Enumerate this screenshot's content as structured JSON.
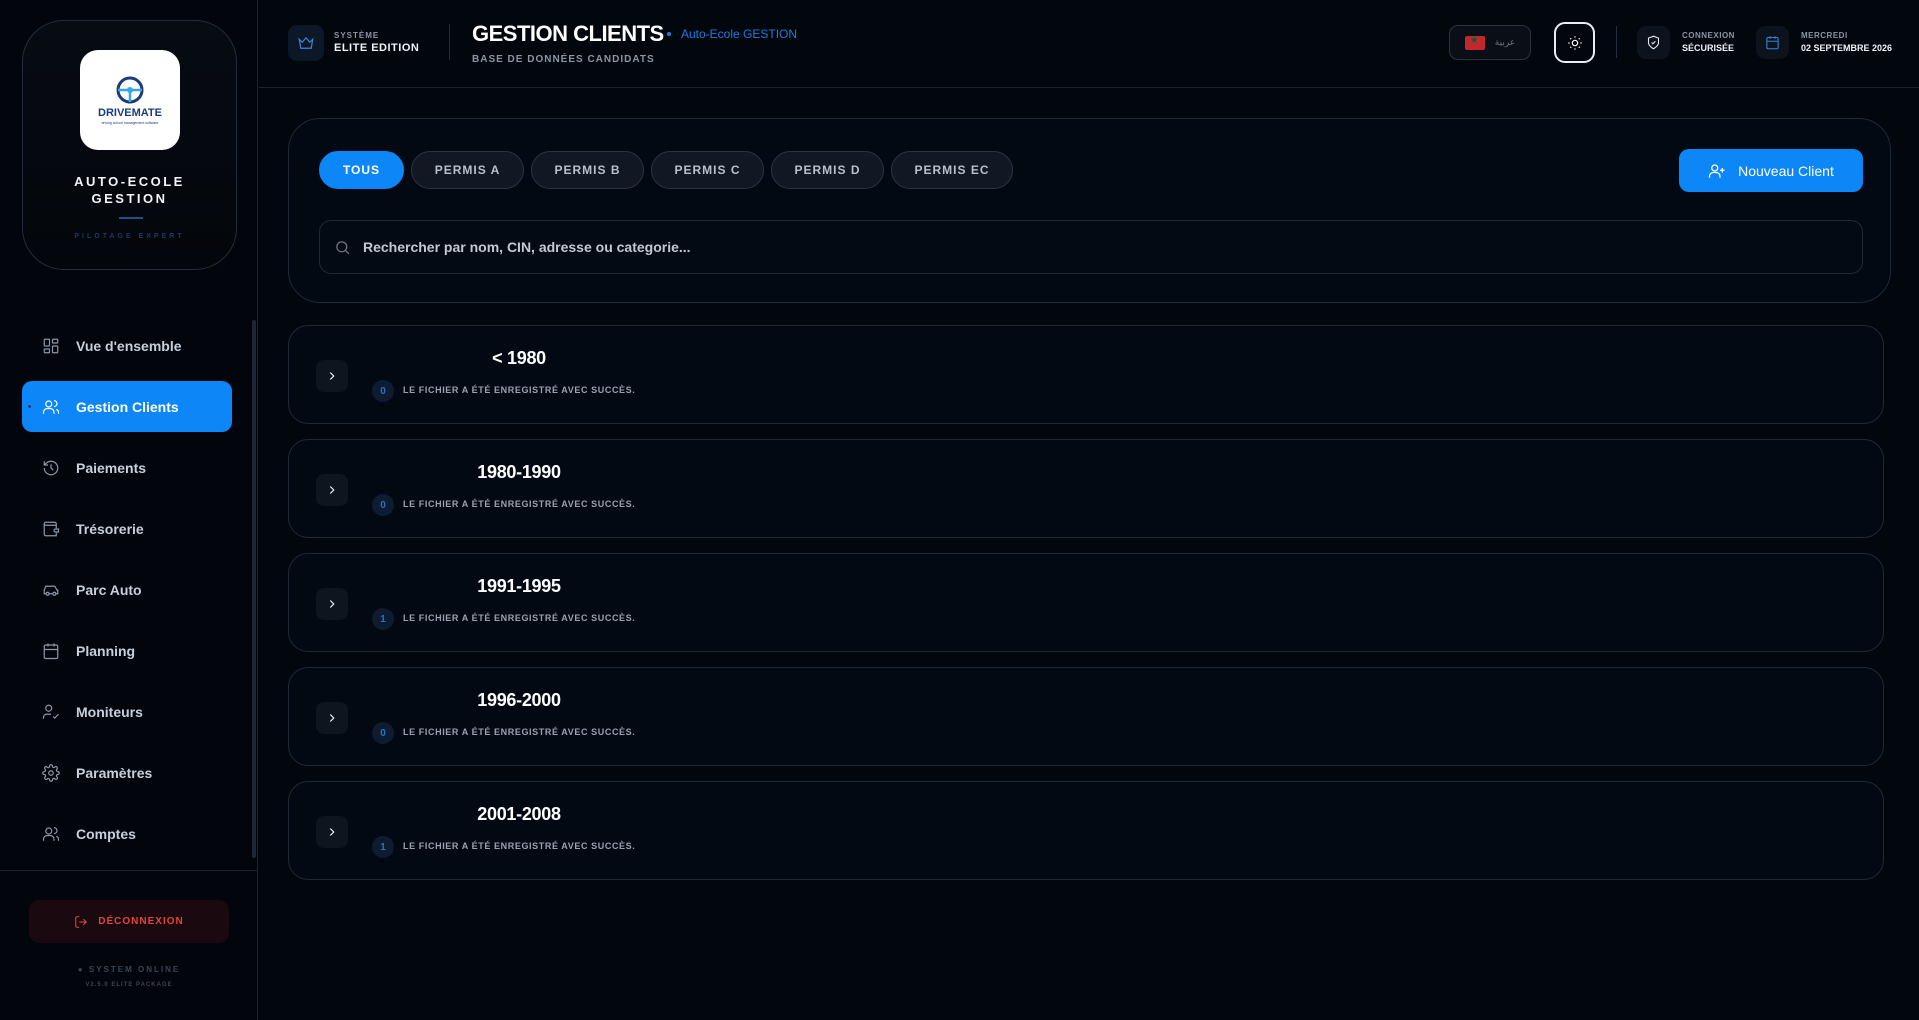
{
  "sidebar": {
    "logo_text": "DRIVEMATE",
    "logo_tagline": "driving school management software",
    "brand_title_line1": "AUTO-ECOLE",
    "brand_title_line2": "GESTION",
    "brand_sub": "PILOTAGE EXPERT",
    "items": [
      {
        "label": "Vue d'ensemble",
        "icon": "dashboard-icon"
      },
      {
        "label": "Gestion Clients",
        "icon": "users-icon",
        "active": true
      },
      {
        "label": "Paiements",
        "icon": "history-icon"
      },
      {
        "label": "Trésorerie",
        "icon": "wallet-icon"
      },
      {
        "label": "Parc Auto",
        "icon": "car-icon"
      },
      {
        "label": "Planning",
        "icon": "calendar-icon"
      },
      {
        "label": "Moniteurs",
        "icon": "user-check-icon"
      },
      {
        "label": "Paramètres",
        "icon": "gear-icon"
      },
      {
        "label": "Comptes",
        "icon": "users-icon"
      }
    ],
    "logout_label": "DÉCONNEXION",
    "status": "● SYSTEM ONLINE",
    "version": "V2.5.0 ELITE PACKAGE"
  },
  "header": {
    "system_label": "SYSTÈME",
    "system_edition": "ELITE EDITION",
    "title": "GESTION CLIENTS",
    "school": "Auto-Ecole GESTION",
    "subtitle": "BASE DE DONNÉES CANDIDATS",
    "language": "عربية",
    "connection_label": "CONNEXION",
    "connection_value": "SÉCURISÉE",
    "day_label": "MERCREDI",
    "date_value": "02 SEPTEMBRE 2026"
  },
  "filters": {
    "pills": [
      "TOUS",
      "PERMIS A",
      "PERMIS B",
      "PERMIS C",
      "PERMIS D",
      "PERMIS EC"
    ],
    "active": "TOUS",
    "new_client_label": "Nouveau Client",
    "search_placeholder": "Rechercher par nom, CIN, adresse ou categorie..."
  },
  "groups": [
    {
      "label": "< 1980",
      "count": "0",
      "status": "LE FICHIER A ÉTÉ ENREGISTRÉ AVEC SUCCÈS."
    },
    {
      "label": "1980-1990",
      "count": "0",
      "status": "LE FICHIER A ÉTÉ ENREGISTRÉ AVEC SUCCÈS."
    },
    {
      "label": "1991-1995",
      "count": "1",
      "status": "LE FICHIER A ÉTÉ ENREGISTRÉ AVEC SUCCÈS."
    },
    {
      "label": "1996-2000",
      "count": "0",
      "status": "LE FICHIER A ÉTÉ ENREGISTRÉ AVEC SUCCÈS."
    },
    {
      "label": "2001-2008",
      "count": "1",
      "status": "LE FICHIER A ÉTÉ ENREGISTRÉ AVEC SUCCÈS."
    }
  ],
  "colors": {
    "accent": "#0d86f7",
    "background": "#02060d",
    "danger": "#e0453f"
  }
}
